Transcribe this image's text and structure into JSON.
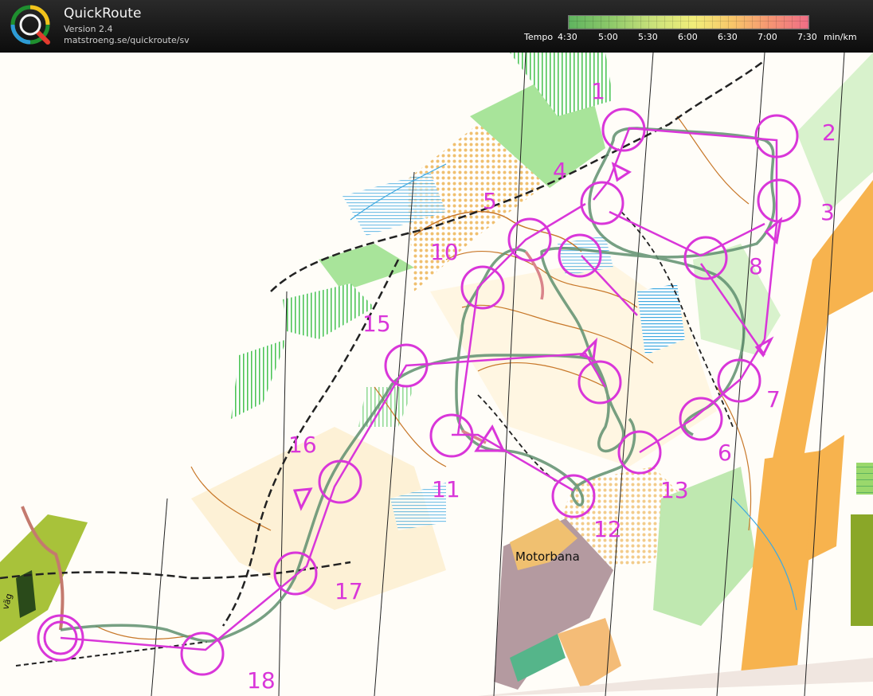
{
  "app": {
    "title": "QuickRoute",
    "version": "Version 2.4",
    "url": "matstroeng.se/quickroute/sv"
  },
  "pace_scale": {
    "prefix": "Tempo",
    "ticks": [
      "4:30",
      "5:00",
      "5:30",
      "6:00",
      "6:30",
      "7:00",
      "7:30"
    ],
    "unit": "min/km",
    "colors": [
      "#5fb35f",
      "#c7e07a",
      "#f2ee7a",
      "#f59573",
      "#ef6e86"
    ]
  },
  "map": {
    "control_color": "#d936d9",
    "route_color": "#5f8f6e",
    "controls": [
      "1",
      "2",
      "3",
      "4",
      "5",
      "6",
      "7",
      "8",
      "10",
      "11",
      "12",
      "13",
      "15",
      "16",
      "17",
      "18"
    ],
    "place_labels": {
      "motorbana": "Motorbana",
      "road": "väg"
    }
  }
}
